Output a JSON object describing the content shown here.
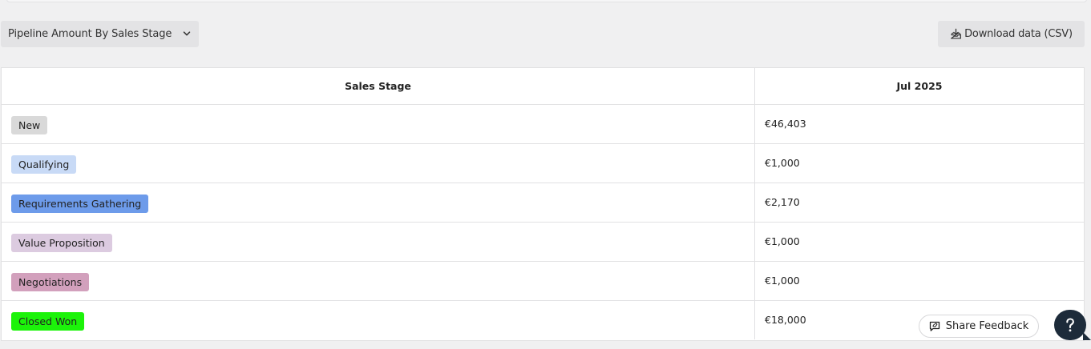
{
  "toolbar": {
    "report_select": {
      "value": "Pipeline Amount By Sales Stage",
      "icon": "chevron-down-icon"
    },
    "download_button": {
      "label": "Download data (CSV)",
      "icon": "download-tray-icon"
    }
  },
  "table": {
    "columns": [
      "Sales Stage",
      "Jul 2025"
    ],
    "rows": [
      {
        "stage": "New",
        "amount": "€46,403",
        "color": "#d9d9d9"
      },
      {
        "stage": "Qualifying",
        "amount": "€1,000",
        "color": "#c8daf6"
      },
      {
        "stage": "Requirements Gathering",
        "amount": "€2,170",
        "color": "#6d9bea"
      },
      {
        "stage": "Value Proposition",
        "amount": "€1,000",
        "color": "#dccbe0"
      },
      {
        "stage": "Negotiations",
        "amount": "€1,000",
        "color": "#d2a0bc"
      },
      {
        "stage": "Closed Won",
        "amount": "€18,000",
        "color": "#1cf30a"
      }
    ]
  },
  "footer": {
    "feedback_button": {
      "label": "Share Feedback",
      "icon": "feedback-chat-icon"
    },
    "help_button": {
      "icon": "question-mark-icon"
    }
  }
}
